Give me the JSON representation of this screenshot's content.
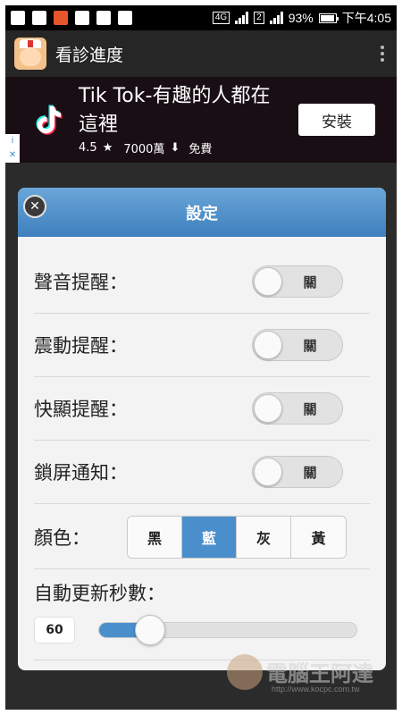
{
  "status_bar": {
    "network_badge": "4G",
    "network_badge_2": "2",
    "battery": "93%",
    "time": "下午4:05",
    "left_icons": [
      "facebook-icon",
      "gmail-icon",
      "app-notification-icon",
      "image-icon",
      "check-icon",
      "location-icon"
    ]
  },
  "app_bar": {
    "title": "看診進度",
    "logo": "nurse-app-logo"
  },
  "ad": {
    "title": "Tik Tok-有趣的人都在這裡",
    "rating": "4.5",
    "downloads": "7000萬",
    "price": "免費",
    "install_label": "安裝",
    "info_icons": [
      "i",
      "✕"
    ],
    "accent_colors": {
      "cyan": "#25f4ee",
      "red": "#fe2c55"
    }
  },
  "dialog": {
    "title": "設定",
    "close_icon": "close-icon",
    "settings": [
      {
        "label": "聲音提醒：",
        "switch_text": "關",
        "on": false
      },
      {
        "label": "震動提醒：",
        "switch_text": "關",
        "on": false
      },
      {
        "label": "快顯提醒：",
        "switch_text": "關",
        "on": false
      },
      {
        "label": "鎖屏通知：",
        "switch_text": "關",
        "on": false
      }
    ],
    "color": {
      "label": "顏色：",
      "options": [
        "黑",
        "藍",
        "灰",
        "黃"
      ],
      "selected": "藍"
    },
    "refresh": {
      "label": "自動更新秒數：",
      "value": "60",
      "fraction": 0.2
    }
  },
  "watermark": {
    "text": "電腦王阿達",
    "url": "http://www.kocpc.com.tw"
  },
  "colors": {
    "accent": "#4a8fcc",
    "header": "#3e7fbd",
    "background": "#2b2b2b"
  }
}
